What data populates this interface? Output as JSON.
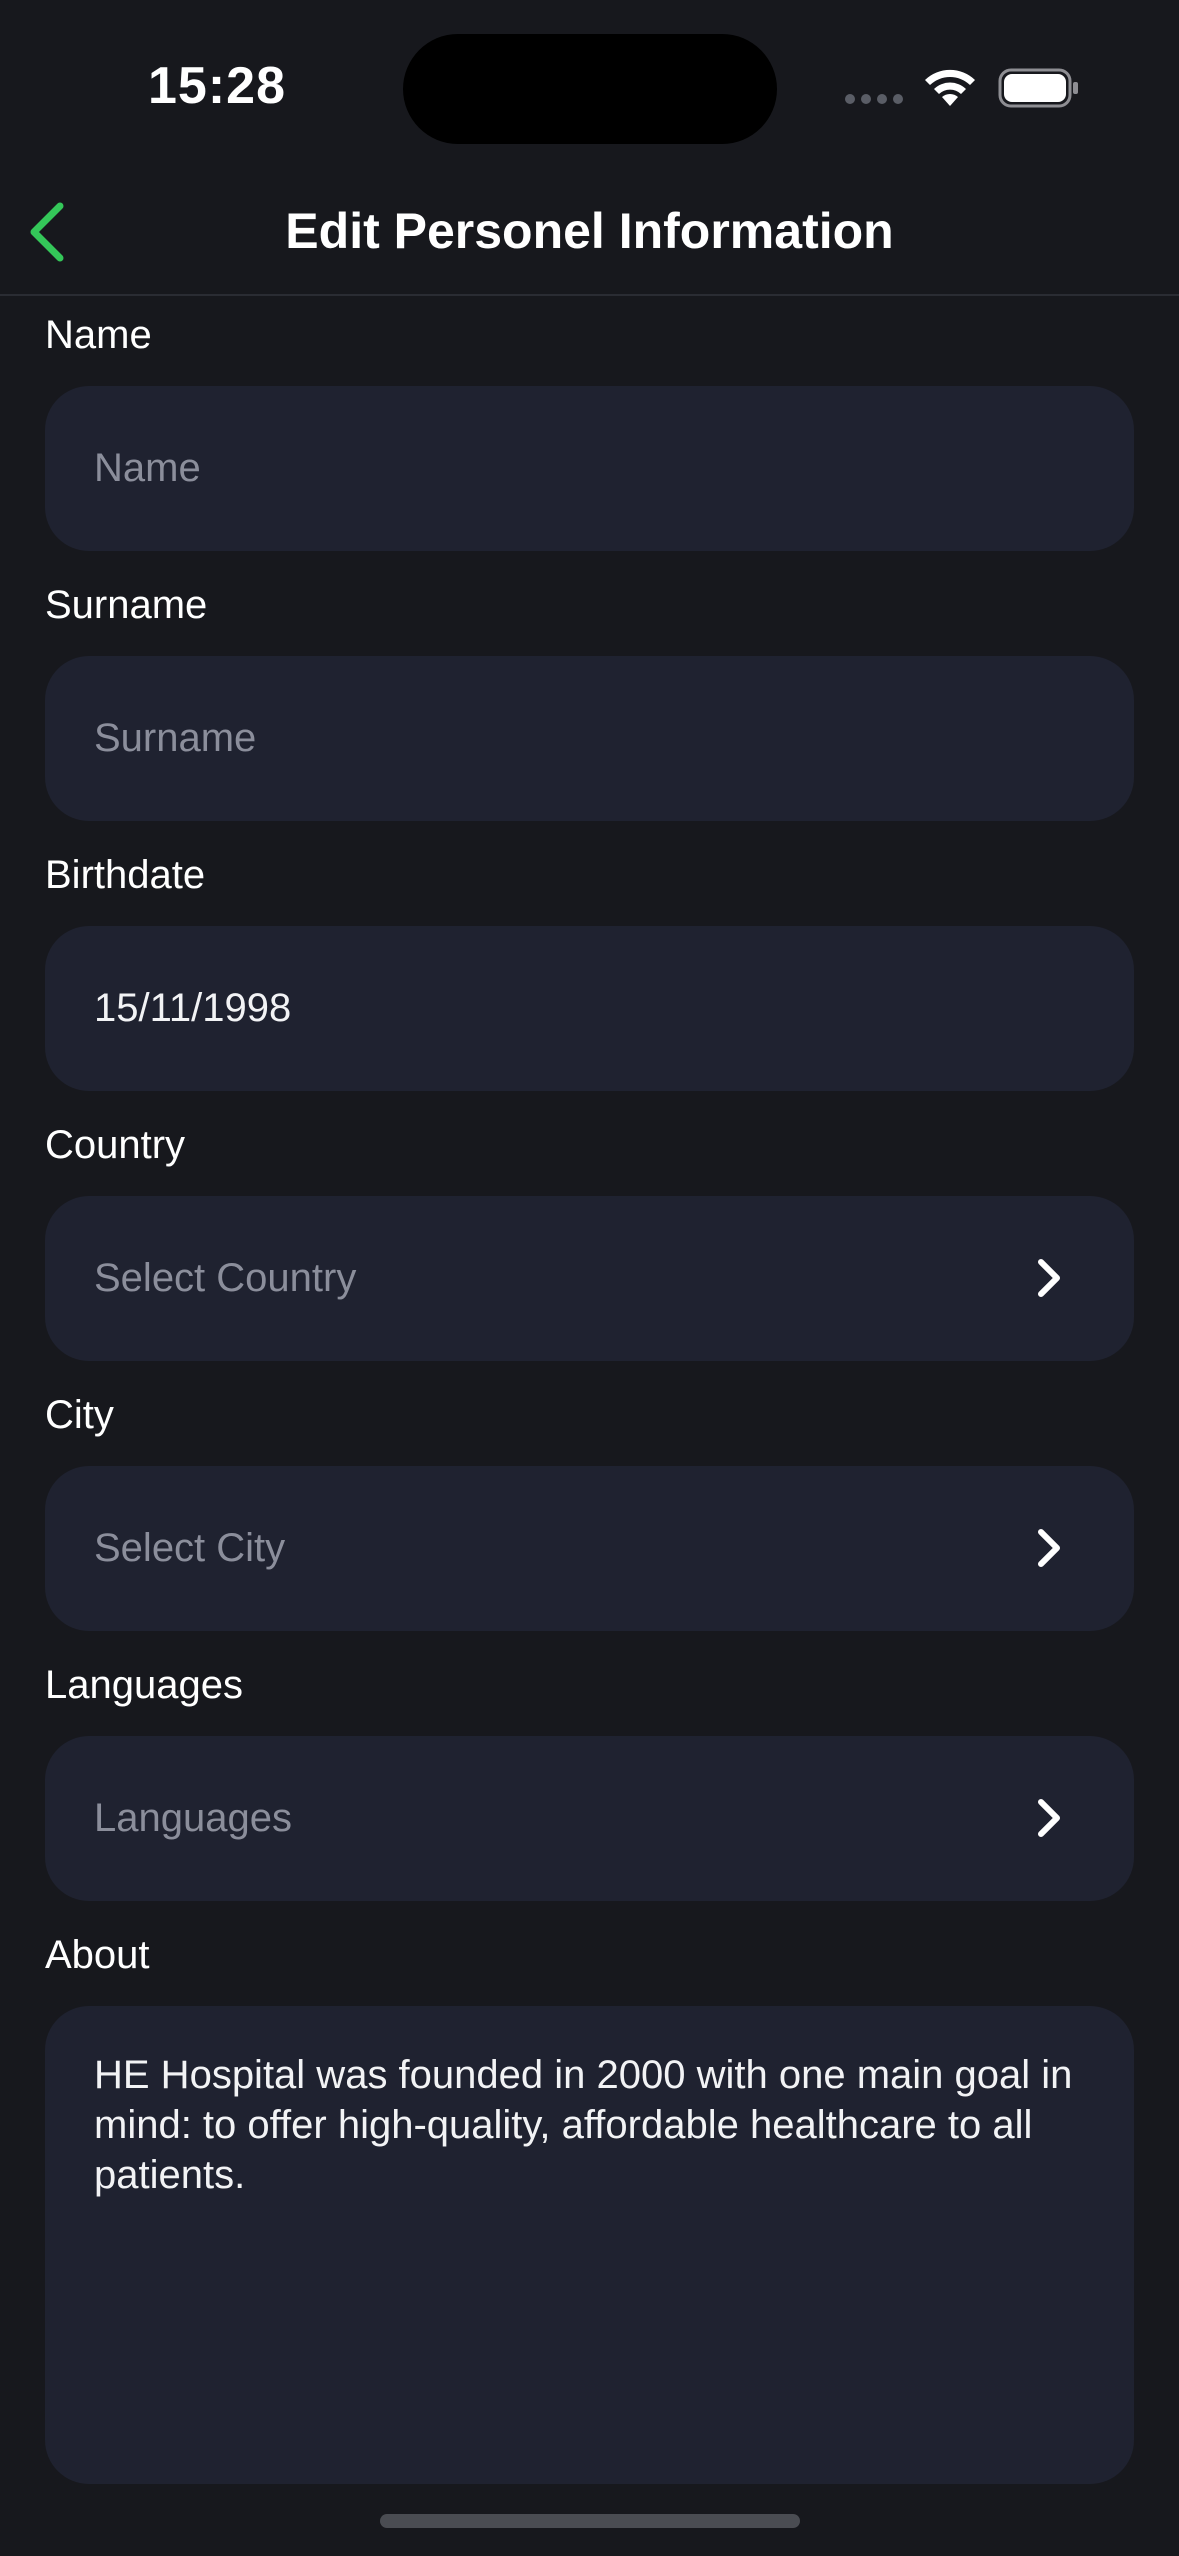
{
  "status_bar": {
    "time": "15:28"
  },
  "header": {
    "title": "Edit Personel Information",
    "back_icon": "chevron-left-icon",
    "accent_color": "#34c759"
  },
  "form": {
    "name": {
      "label": "Name",
      "placeholder": "Name",
      "value": ""
    },
    "surname": {
      "label": "Surname",
      "placeholder": "Surname",
      "value": ""
    },
    "birthdate": {
      "label": "Birthdate",
      "value": "15/11/1998"
    },
    "country": {
      "label": "Country",
      "placeholder": "Select Country",
      "icon": "chevron-right-icon"
    },
    "city": {
      "label": "City",
      "placeholder": "Select City",
      "icon": "chevron-right-icon"
    },
    "languages": {
      "label": "Languages",
      "placeholder": "Languages",
      "icon": "chevron-right-icon"
    },
    "about": {
      "label": "About",
      "value": "HE Hospital was founded in 2000 with one main goal in mind: to offer high-quality, affordable healthcare to all patients."
    }
  }
}
